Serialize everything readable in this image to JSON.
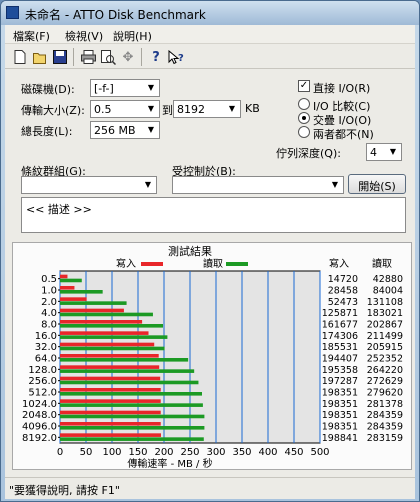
{
  "window": {
    "title": "未命名 - ATTO Disk Benchmark"
  },
  "menu": [
    "檔案(F)",
    "檢視(V)",
    "說明(H)"
  ],
  "toolbar_icons": [
    "new-file-icon",
    "open-folder-icon",
    "save-icon",
    "print-icon",
    "print-preview-icon",
    "move-icon",
    "help-icon",
    "context-help-icon"
  ],
  "form": {
    "drive_label": "磁碟機(D):",
    "drive_value": "[-f-]",
    "transfer_label": "傳輸大小(Z):",
    "transfer_from": "0.5",
    "to_label": "到",
    "transfer_to": "8192",
    "kb_label": "KB",
    "total_label": "總長度(L):",
    "total_value": "256 MB",
    "direct_io_label": "直接 I/O(R)",
    "io_compare_label": "I/O 比較(C)",
    "overlapped_io_label": "交疊 I/O(O)",
    "neither_label": "兩者都不(N)",
    "queue_label": "佇列深度(Q):",
    "queue_value": "4",
    "group_label": "條紋群組(G):",
    "controlled_label": "受控制於(B):",
    "start_button": "開始(S)",
    "description": "<< 描述 >>"
  },
  "chart_data": {
    "type": "bar",
    "title": "測試結果",
    "legend": {
      "write": "寫入",
      "read": "讀取"
    },
    "categories": [
      "0.5",
      "1.0",
      "2.0",
      "4.0",
      "8.0",
      "16.0",
      "32.0",
      "64.0",
      "128.0",
      "256.0",
      "512.0",
      "1024.0",
      "2048.0",
      "4096.0",
      "8192.0"
    ],
    "series": [
      {
        "name": "寫入",
        "color": "#e8262a",
        "values": [
          14720,
          28458,
          52473,
          125871,
          161677,
          174306,
          185531,
          194407,
          195358,
          197287,
          198351,
          198351,
          198351,
          198351,
          198841
        ]
      },
      {
        "name": "讀取",
        "color": "#1c9a24",
        "values": [
          42880,
          84004,
          131108,
          183021,
          202867,
          211499,
          205915,
          252352,
          264220,
          272629,
          279620,
          281378,
          284359,
          284359,
          283159
        ]
      }
    ],
    "xlabel": "傳輸速率 - MB / 秒",
    "xticks": [
      "0",
      "50",
      "100",
      "150",
      "200",
      "250",
      "300",
      "350",
      "400",
      "450",
      "500"
    ],
    "xlim": [
      0,
      500
    ],
    "column_headers": {
      "write": "寫入",
      "read": "讀取"
    },
    "grid": true
  },
  "status": {
    "text": "\"要獲得說明, 請按 F1\""
  },
  "colors": {
    "write": "#e8262a",
    "read": "#1c9a24",
    "plot_bg": "#e4e4e4"
  }
}
